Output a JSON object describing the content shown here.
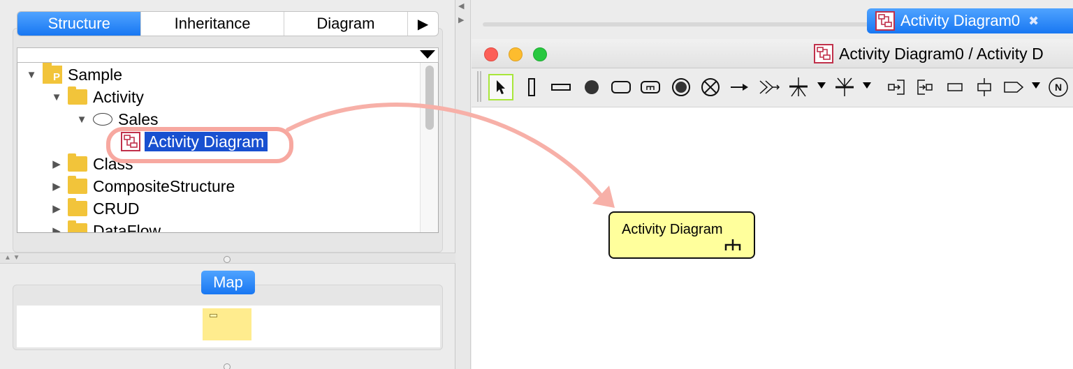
{
  "left_panel": {
    "tabs": [
      {
        "label": "Structure",
        "active": true
      },
      {
        "label": "Inheritance",
        "active": false
      },
      {
        "label": "Diagram",
        "active": false
      }
    ],
    "tree": {
      "root": "Sample",
      "items": [
        {
          "label": "Activity",
          "type": "folder",
          "expanded": true
        },
        {
          "label": "Sales",
          "type": "partition",
          "expanded": true
        },
        {
          "label": "Activity Diagram",
          "type": "diagram",
          "selected": true
        },
        {
          "label": "Class",
          "type": "folder",
          "expanded": false
        },
        {
          "label": "CompositeStructure",
          "type": "folder",
          "expanded": false
        },
        {
          "label": "CRUD",
          "type": "folder",
          "expanded": false
        },
        {
          "label": "DataFlow",
          "type": "folder",
          "expanded": false
        }
      ]
    },
    "map_label": "Map"
  },
  "right_panel": {
    "doc_tab": "Activity Diagram0",
    "window_title": "Activity Diagram0 / Activity D",
    "canvas_node": "Activity Diagram"
  },
  "colors": {
    "accent_blue": "#1877f2",
    "selection": "#1850d0",
    "folder": "#f2c43a",
    "node_fill": "#ffff9c",
    "highlight": "#f7a8a0",
    "select_tool_border": "#a8e63a"
  }
}
